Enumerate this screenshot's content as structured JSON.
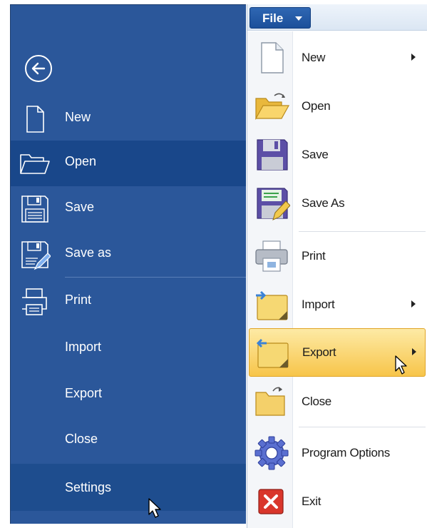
{
  "backstage": {
    "items": [
      {
        "label": "New"
      },
      {
        "label": "Open"
      },
      {
        "label": "Save"
      },
      {
        "label": "Save as"
      },
      {
        "label": "Print"
      },
      {
        "label": "Import"
      },
      {
        "label": "Export"
      },
      {
        "label": "Close"
      },
      {
        "label": "Settings"
      }
    ],
    "selected": "Open",
    "hovered": "Settings"
  },
  "classic_menu": {
    "file_button": "File",
    "items": [
      {
        "label": "New",
        "submenu": true,
        "icon": "new-file-icon"
      },
      {
        "label": "Open",
        "icon": "folder-open-icon"
      },
      {
        "label": "Save",
        "icon": "floppy-disk-icon"
      },
      {
        "label": "Save As",
        "icon": "save-as-icon"
      },
      {
        "label": "Print",
        "icon": "printer-icon"
      },
      {
        "label": "Import",
        "submenu": true,
        "icon": "import-icon"
      },
      {
        "label": "Export",
        "submenu": true,
        "icon": "export-icon"
      },
      {
        "label": "Close",
        "icon": "close-folder-icon"
      },
      {
        "label": "Program Options",
        "icon": "gear-icon"
      },
      {
        "label": "Exit",
        "icon": "exit-icon"
      }
    ],
    "highlighted": "Export"
  },
  "colors": {
    "backstage_bg": "#2b579a",
    "backstage_selected": "#19478a",
    "menu_highlight": "#f7c54a"
  }
}
